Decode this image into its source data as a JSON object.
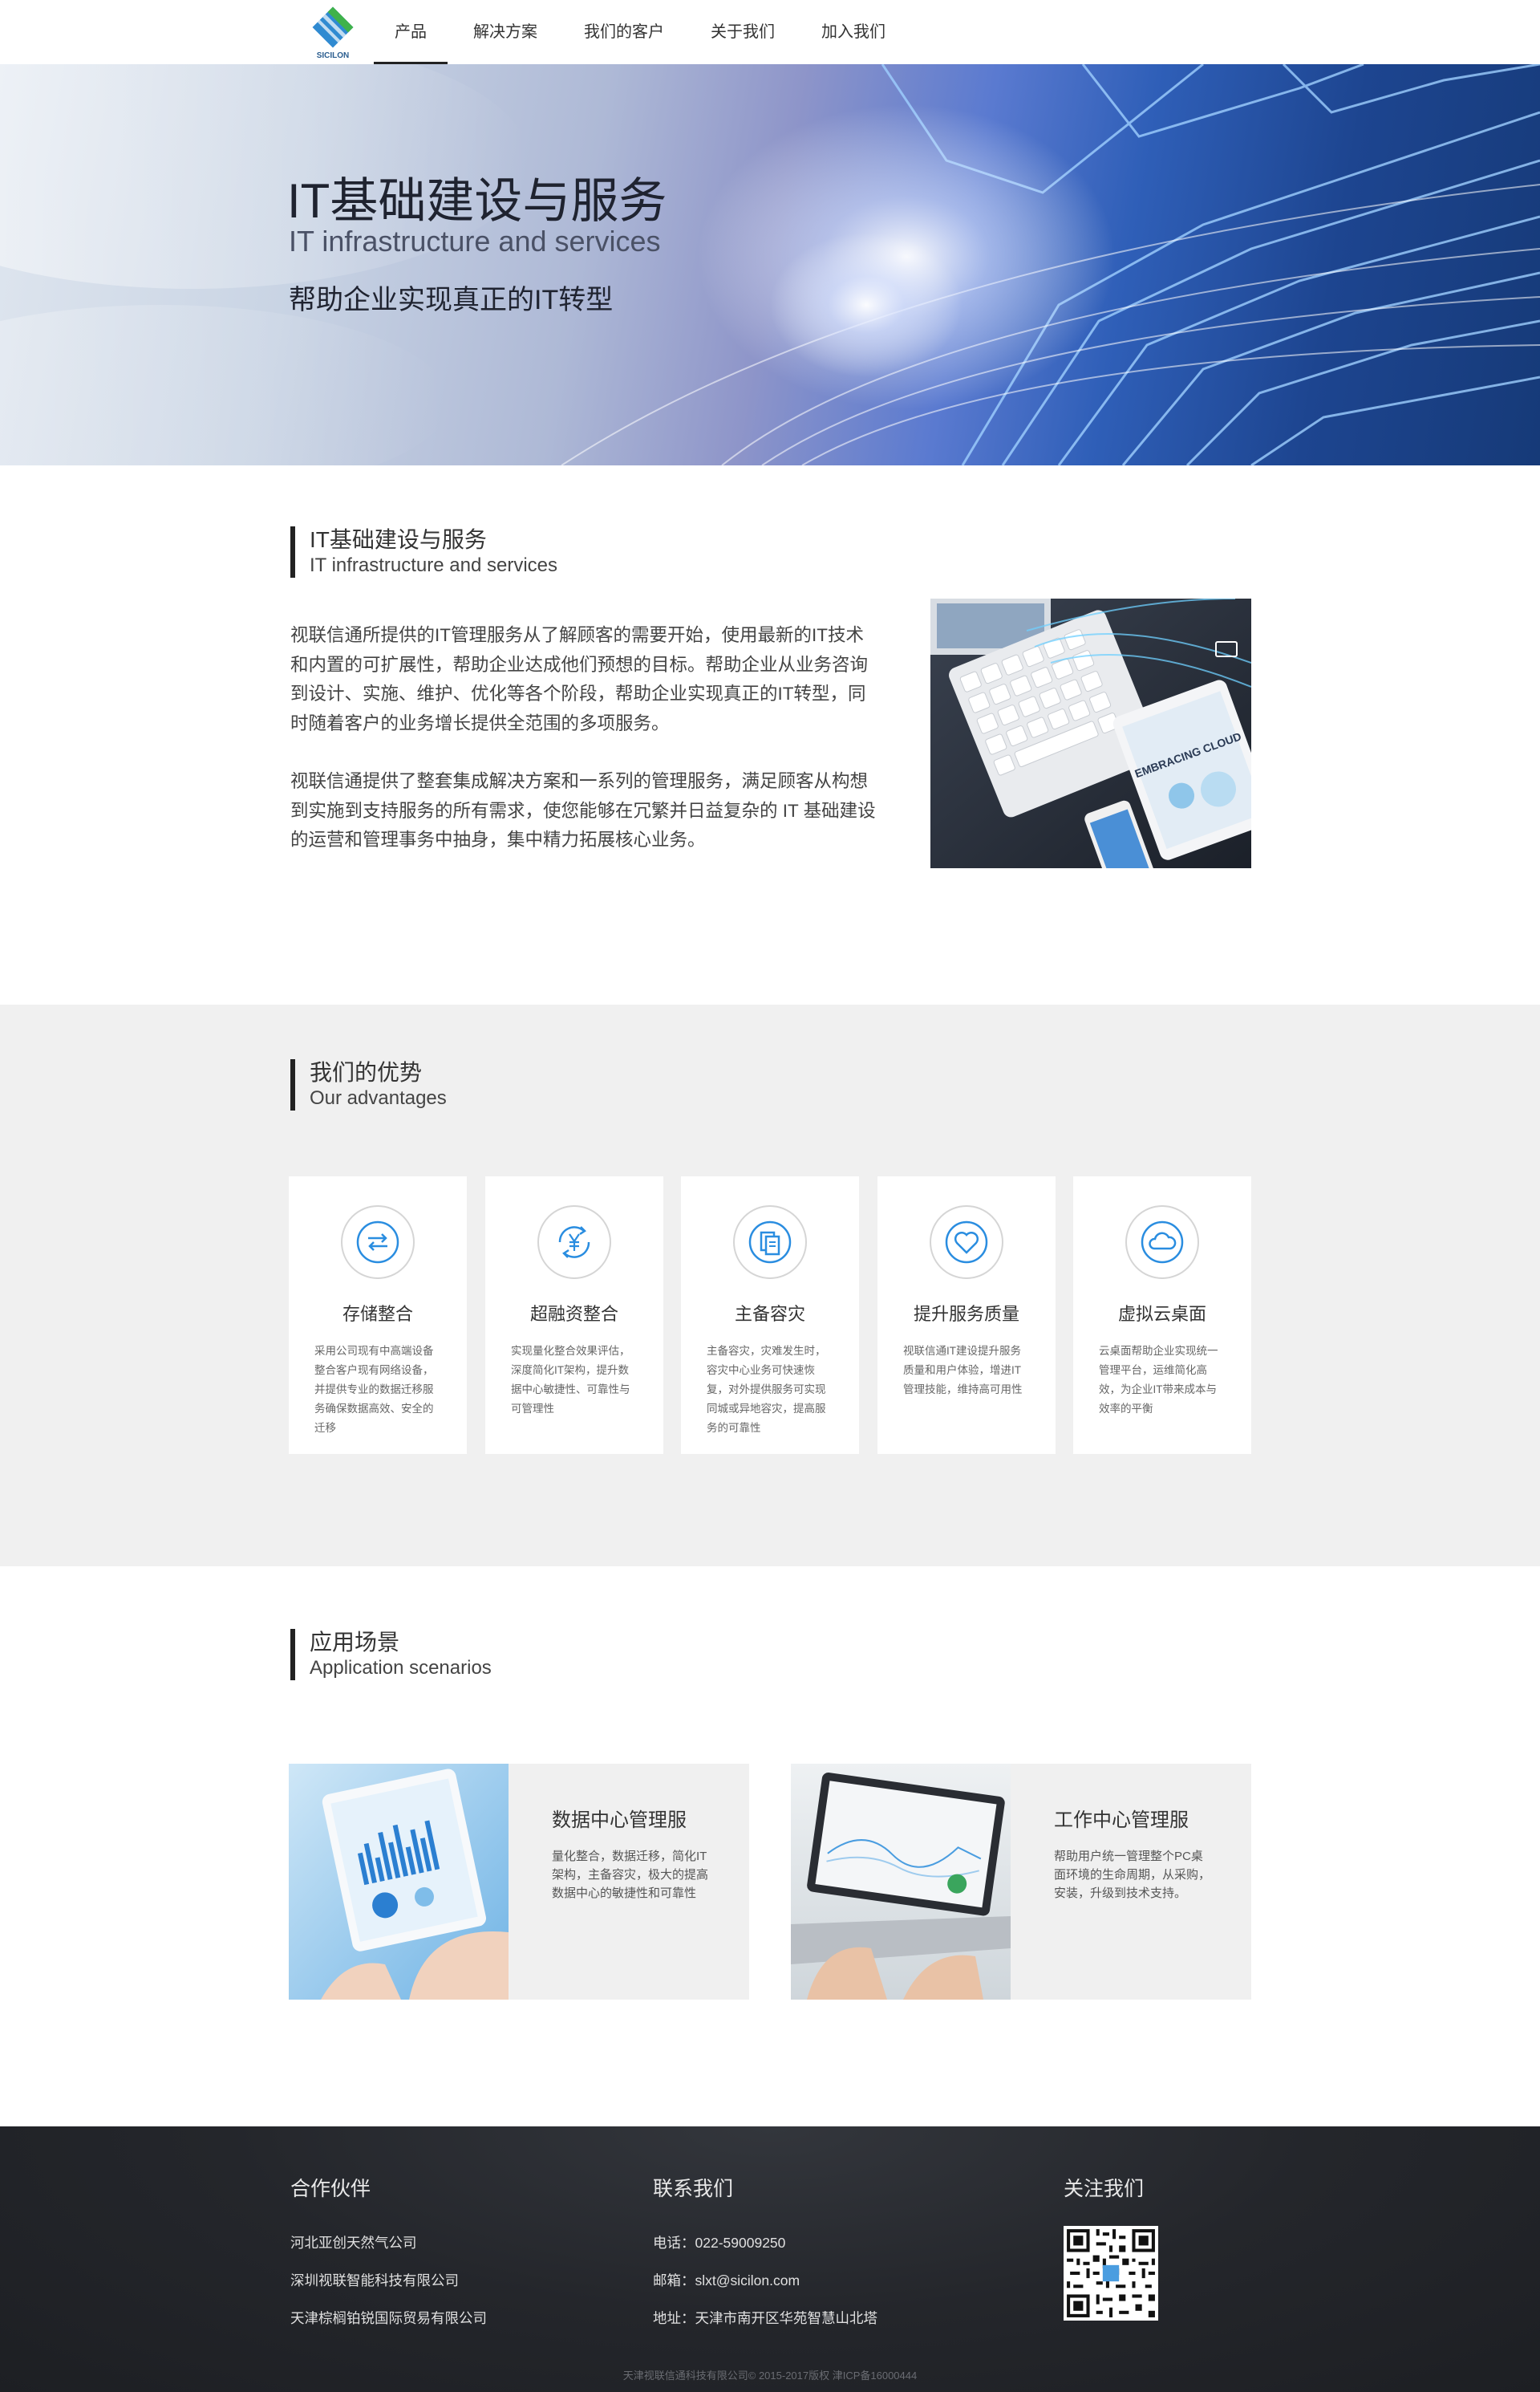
{
  "nav": {
    "logo_text": "SICILON",
    "items": [
      {
        "label": "产品",
        "active": true
      },
      {
        "label": "解决方案"
      },
      {
        "label": "我们的客户"
      },
      {
        "label": "关于我们"
      },
      {
        "label": "加入我们"
      }
    ]
  },
  "hero": {
    "title": "IT基础建设与服务",
    "subtitle": "IT infrastructure and services",
    "tagline": "帮助企业实现真正的IT转型"
  },
  "intro": {
    "heading_zh": "IT基础建设与服务",
    "heading_en": "IT infrastructure and services",
    "paragraphs": [
      "视联信通所提供的IT管理服务从了解顾客的需要开始，使用最新的IT技术和内置的可扩展性，帮助企业达成他们预想的目标。帮助企业从业务咨询到设计、实施、维护、优化等各个阶段，帮助企业实现真正的IT转型，同时随着客户的业务增长提供全范围的多项服务。",
      "视联信通提供了整套集成解决方案和一系列的管理服务，满足顾客从构想到实施到支持服务的所有需求，使您能够在冗繁并日益复杂的 IT 基础建设的运营和管理事务中抽身，集中精力拓展核心业务。"
    ],
    "image_text": "EMBRACING CLOUD"
  },
  "advantages": {
    "heading_zh": "我们的优势",
    "heading_en": "Our advantages",
    "accent_color": "#2a8de0",
    "cards": [
      {
        "icon": "transfer-arrows-icon",
        "title": "存储整合",
        "desc": "采用公司现有中高端设备整合客户现有网络设备，并提供专业的数据迁移服务确保数据高效、安全的迁移"
      },
      {
        "icon": "yuan-cycle-icon",
        "title": "超融资整合",
        "desc": "实现量化整合效果评估，深度简化IT架构，提升数据中心敏捷性、可靠性与可管理性"
      },
      {
        "icon": "file-backup-icon",
        "title": "主备容灾",
        "desc": "主备容灾，灾难发生时，容灾中心业务可快速恢复，对外提供服务可实现同城或异地容灾，提高服务的可靠性"
      },
      {
        "icon": "heart-icon",
        "title": "提升服务质量",
        "desc": "视联信通IT建设提升服务质量和用户体验，增进IT管理技能，维持高可用性"
      },
      {
        "icon": "cloud-icon",
        "title": "虚拟云桌面",
        "desc": "云桌面帮助企业实现统一管理平台，运维简化高效，为企业IT带来成本与效率的平衡"
      }
    ]
  },
  "scenarios": {
    "heading_zh": "应用场景",
    "heading_en": "Application scenarios",
    "items": [
      {
        "title": "数据中心管理服",
        "desc": "量化整合，数据迁移，简化IT架构，主备容灾，极大的提高数据中心的敏捷性和可靠性"
      },
      {
        "title": "工作中心管理服",
        "desc": "帮助用户统一管理整个PC桌面环境的生命周期，从采购，安装，升级到技术支持。"
      }
    ]
  },
  "footer": {
    "partners_title": "合作伙伴",
    "partners": [
      "河北亚创天然气公司",
      "深圳视联智能科技有限公司",
      "天津棕榈铂锐国际贸易有限公司"
    ],
    "contact_title": "联系我们",
    "contact": [
      "电话：022-59009250",
      "邮箱：slxt@sicilon.com",
      "地址：天津市南开区华苑智慧山北塔"
    ],
    "follow_title": "关注我们",
    "copyright": "天津视联信通科技有限公司© 2015-2017版权 津ICP备16000444"
  }
}
